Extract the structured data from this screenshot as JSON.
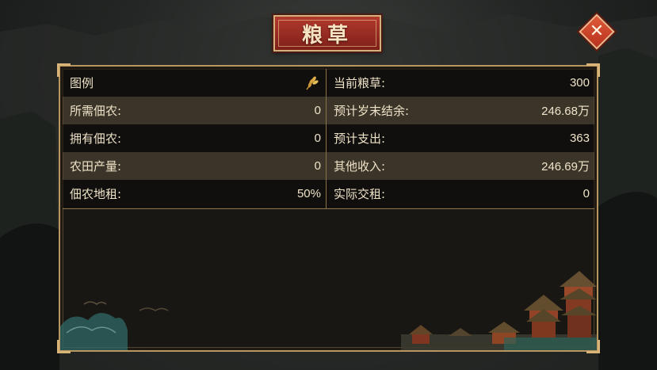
{
  "title": "粮草",
  "close": {
    "icon": "close-icon"
  },
  "legend": {
    "label": "图例",
    "icon": "wheat-icon"
  },
  "left_rows": [
    {
      "label": "所需佃农:",
      "value": "0"
    },
    {
      "label": "拥有佃农:",
      "value": "0"
    },
    {
      "label": "农田产量:",
      "value": "0"
    },
    {
      "label": "佃农地租:",
      "value": "50%"
    }
  ],
  "right_rows": [
    {
      "label": "当前粮草:",
      "value": "300"
    },
    {
      "label": "预计岁末结余:",
      "value": "246.68万"
    },
    {
      "label": "预计支出:",
      "value": "363"
    },
    {
      "label": "其他收入:",
      "value": "246.69万"
    },
    {
      "label": "实际交租:",
      "value": "0"
    }
  ],
  "colors": {
    "accent": "#b23a2e",
    "border": "#b89660",
    "close": "#d9472b"
  }
}
